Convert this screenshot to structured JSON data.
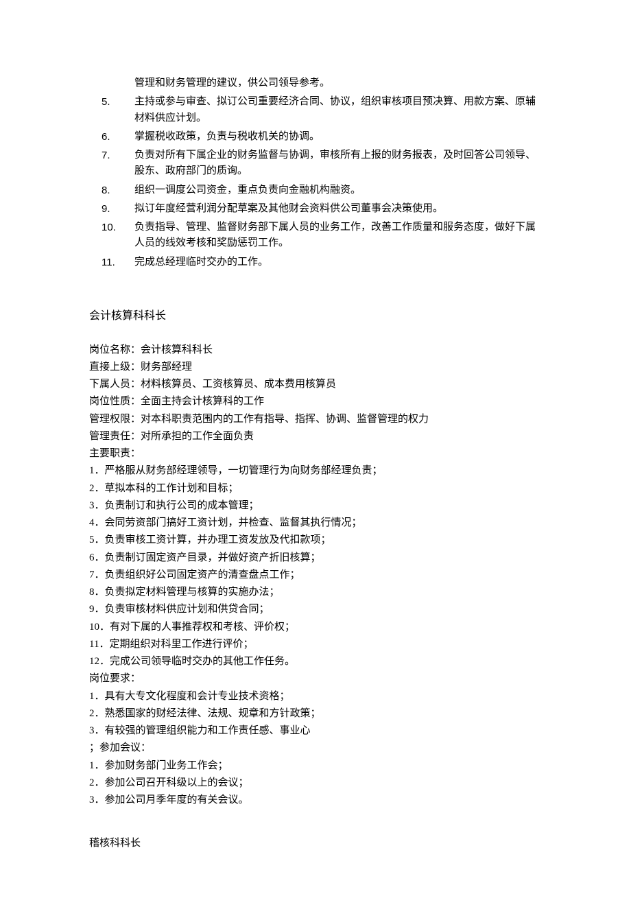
{
  "top_list": [
    {
      "n": "",
      "t": "管理和财务管理的建议，供公司领导参考。"
    },
    {
      "n": "5.",
      "t": "主持或参与审查、拟订公司重要经济合同、协议，组织审核项目预决算、用款方案、原辅材料供应计划。"
    },
    {
      "n": "6.",
      "t": "掌握税收政策，负责与税收机关的协调。"
    },
    {
      "n": "7.",
      "t": "负责对所有下属企业的财务监督与协调，审核所有上报的财务报表，及时回答公司领导、股东、政府部门的质询。"
    },
    {
      "n": "8.",
      "t": "组织一调度公司资金，重点负责向金融机构融资。"
    },
    {
      "n": "9.",
      "t": "拟订年度经营利润分配草案及其他财会资料供公司董事会决策使用。"
    },
    {
      "n": "10.",
      "t": "负责指导、管理、监督财务部下属人员的业务工作，改善工作质量和服务态度，做好下属人员的线效考核和奖励惩罚工作。"
    },
    {
      "n": "11.",
      "t": "完成总经理临时交办的工作。"
    }
  ],
  "section1": {
    "title": "会计核算科科长",
    "fields": [
      "岗位名称：会计核算科科长",
      "直接上级：财务部经理",
      "下属人员：材料核算员、工资核算员、成本费用核算员",
      "岗位性质：全面主持会计核算科的工作",
      "管理权限：对本科职责范围内的工作有指导、指挥、协调、监督管理的权力",
      "管理责任：对所承担的工作全面负责",
      "主要职责："
    ],
    "duties": [
      "1．严格服从财务部经理领导，一切管理行为向财务部经理负责；",
      "2．草拟本科的工作计划和目标；",
      "3．负责制订和执行公司的成本管理；",
      "4．会同劳资部门搞好工资计划，并检查、监督其执行情况；",
      "5．负责审核工资计算，并办理工资发放及代扣款项；",
      "6．负责制订固定资产目录，并做好资产折旧核算；",
      "7．负责组织好公司固定资产的清查盘点工作；",
      "8．负责拟定材料管理与核算的实施办法；",
      "9．负责审核材料供应计划和供贷合同；",
      "10．有对下属的人事推荐权和考核、评价权；",
      "11．定期组织对科里工作进行评价；",
      "12．完成公司领导临时交办的其他工作任务。"
    ],
    "req_label": "岗位要求：",
    "reqs": [
      "1．具有大专文化程度和会计专业技术资格；",
      "2．熟悉国家的财经法律、法规、规章和方针政策；",
      "3．有较强的管理组织能力和工作责任感、事业心"
    ],
    "meeting_label": "；参加会议：",
    "meetings": [
      "1．参加财务部门业务工作会；",
      "2．参加公司召开科级以上的会议；",
      "3．参加公司月季年度的有关会议。"
    ]
  },
  "section2_title": "稽核科科长"
}
